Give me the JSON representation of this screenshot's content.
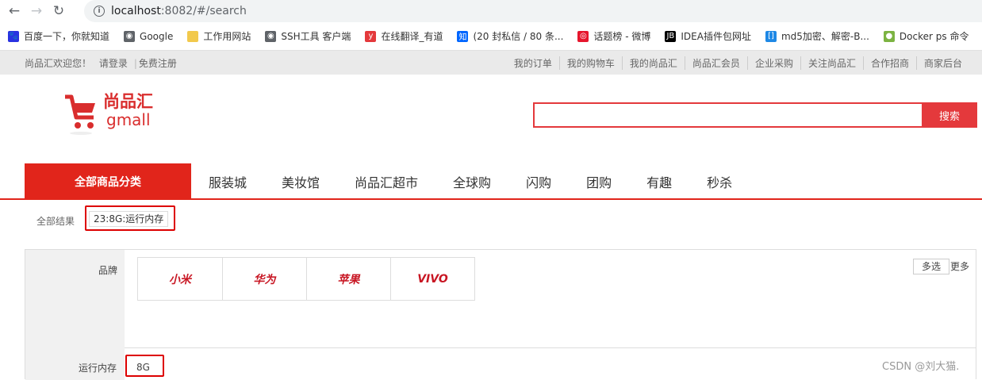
{
  "browser": {
    "url_host": "localhost",
    "url_rest": ":8082/#/search",
    "bookmarks": [
      {
        "label": "百度一下，你就知道",
        "icon": "baidu-paw-icon",
        "color": "#2932e1"
      },
      {
        "label": "Google",
        "icon": "globe-icon",
        "color": "#5f6368"
      },
      {
        "label": "工作用网站",
        "icon": "folder-icon",
        "color": "#f2c94c"
      },
      {
        "label": "SSH工具 客户端",
        "icon": "globe-icon",
        "color": "#5f6368"
      },
      {
        "label": "在线翻译_有道",
        "icon": "youdao-icon",
        "color": "#e4393c"
      },
      {
        "label": "(20 封私信 / 80 条...",
        "icon": "zhihu-icon",
        "color": "#0066ff"
      },
      {
        "label": "话题榜 - 微博",
        "icon": "weibo-icon",
        "color": "#e6162d"
      },
      {
        "label": "IDEA插件包网址",
        "icon": "jetbrains-icon",
        "color": "#000000"
      },
      {
        "label": "md5加密、解密-B...",
        "icon": "bracket-icon",
        "color": "#1e88e5"
      },
      {
        "label": "Docker ps 命令",
        "icon": "runoob-icon",
        "color": "#7cb342"
      }
    ]
  },
  "topbar": {
    "welcome": "尚品汇欢迎您！",
    "login": "请登录",
    "register": "免费注册",
    "links": [
      "我的订单",
      "我的购物车",
      "我的尚品汇",
      "尚品汇会员",
      "企业采购",
      "关注尚品汇",
      "合作招商",
      "商家后台"
    ]
  },
  "header": {
    "logo_cn": "尚品汇",
    "logo_en": "gmall",
    "search_value": "",
    "search_button": "搜索"
  },
  "nav": {
    "all_categories": "全部商品分类",
    "items": [
      "服装城",
      "美妆馆",
      "尚品汇超市",
      "全球购",
      "闪购",
      "团购",
      "有趣",
      "秒杀"
    ]
  },
  "crumb": {
    "label": "全部结果",
    "chip": "23:8G:运行内存"
  },
  "filters": {
    "brand_label": "品牌",
    "brands": [
      "小米",
      "华为",
      "苹果",
      "VIVO"
    ],
    "multi_select": "多选",
    "more": "更多",
    "memory_label": "运行内存",
    "memory_value": "8G"
  },
  "watermark": "CSDN @刘大猫.",
  "colors": {
    "accent": "#e1251b",
    "highlight_box": "#dd0000",
    "brand_text": "#c81623"
  }
}
